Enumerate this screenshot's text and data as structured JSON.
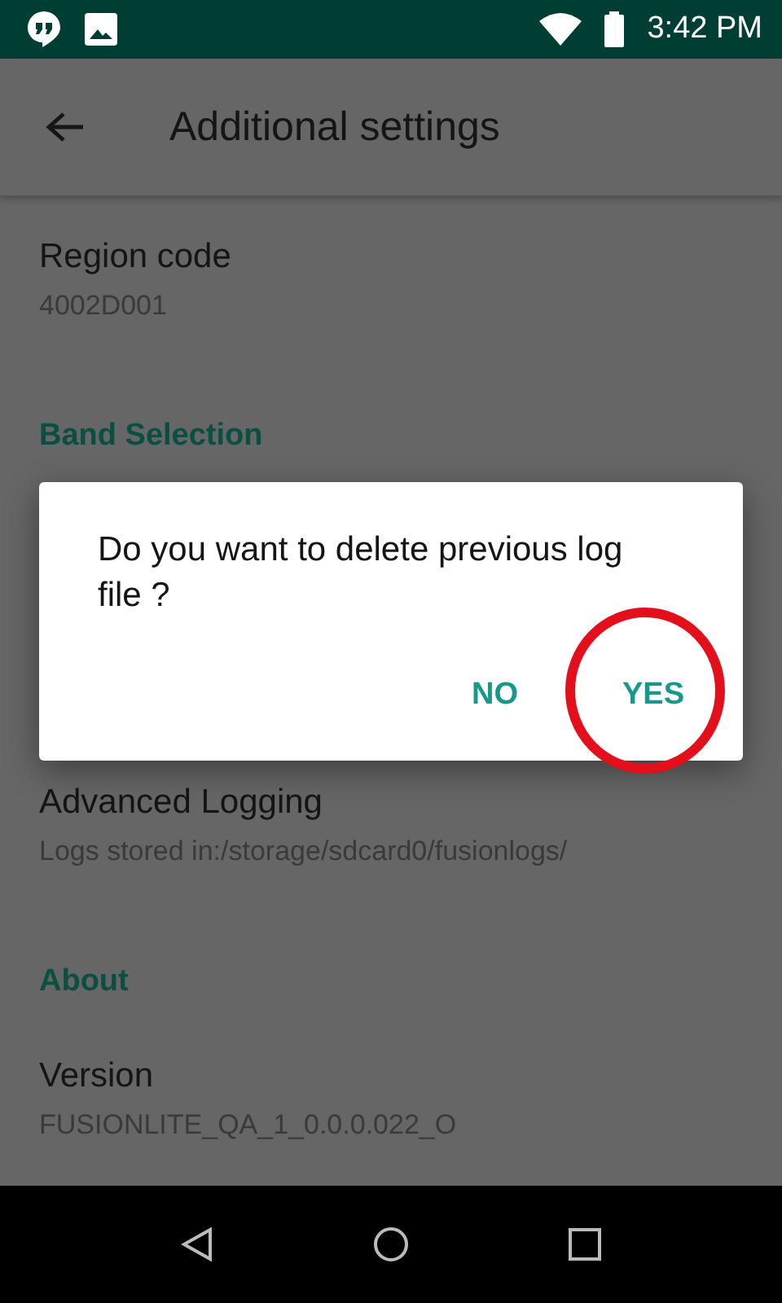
{
  "status_bar": {
    "time": "3:42 PM"
  },
  "toolbar": {
    "title": "Additional settings"
  },
  "settings": [
    {
      "kind": "item",
      "title": "Region code",
      "value": "4002D001"
    },
    {
      "kind": "header",
      "title": "Band Selection"
    },
    {
      "kind": "item",
      "title": "Advanced Logging",
      "value": "Logs stored in:/storage/sdcard0/fusionlogs/"
    },
    {
      "kind": "header",
      "title": "About"
    },
    {
      "kind": "item",
      "title": "Version",
      "value": "FUSIONLITE_QA_1_0.0.0.022_O"
    }
  ],
  "dialog": {
    "message": "Do you want to delete previous log file ?",
    "buttons": [
      {
        "label": "NO",
        "circled": false
      },
      {
        "label": "YES",
        "circled": true
      }
    ]
  }
}
